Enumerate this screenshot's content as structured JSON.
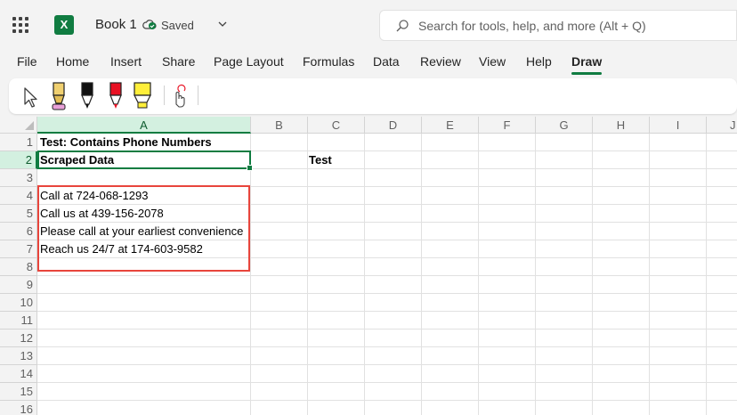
{
  "app": {
    "name": "Excel",
    "logo_letter": "X",
    "document_title": "Book 1",
    "save_status": "Saved"
  },
  "search": {
    "placeholder": "Search for tools, help, and more (Alt + Q)"
  },
  "menu": {
    "items": [
      "File",
      "Home",
      "Insert",
      "Share",
      "Page Layout",
      "Formulas",
      "Data",
      "Review",
      "View",
      "Help",
      "Draw"
    ],
    "active": "Draw"
  },
  "draw_tools": [
    {
      "name": "select-cursor-icon"
    },
    {
      "name": "pencil-icon",
      "color": "#f0d070"
    },
    {
      "name": "black-pen-icon",
      "color": "#111111"
    },
    {
      "name": "red-pen-icon",
      "color": "#e81123"
    },
    {
      "name": "yellow-highlighter-icon",
      "color": "#ffef3a"
    },
    {
      "name": "touch-drawing-icon"
    }
  ],
  "grid": {
    "columns": [
      "A",
      "B",
      "C",
      "D",
      "E",
      "F",
      "G",
      "H",
      "I",
      "J"
    ],
    "selected_column": "A",
    "rows": [
      "1",
      "2",
      "3",
      "4",
      "5",
      "6",
      "7",
      "8",
      "9",
      "10",
      "11",
      "12",
      "13",
      "14",
      "15",
      "16"
    ],
    "selected_row": "2",
    "active_cell": "A2",
    "highlight_range": "A4:A8",
    "highlight_color": "#e8453c",
    "accent_color": "#107c41"
  },
  "cells": {
    "A1": "Test: Contains Phone Numbers",
    "A2": "Scraped Data",
    "C2": "Test",
    "A4": "Call at 724-068-1293",
    "A5": "Call us at 439-156-2078",
    "A6": "Please call at your earliest convenience",
    "A7": "Reach us 24/7 at 174-603-9582"
  }
}
